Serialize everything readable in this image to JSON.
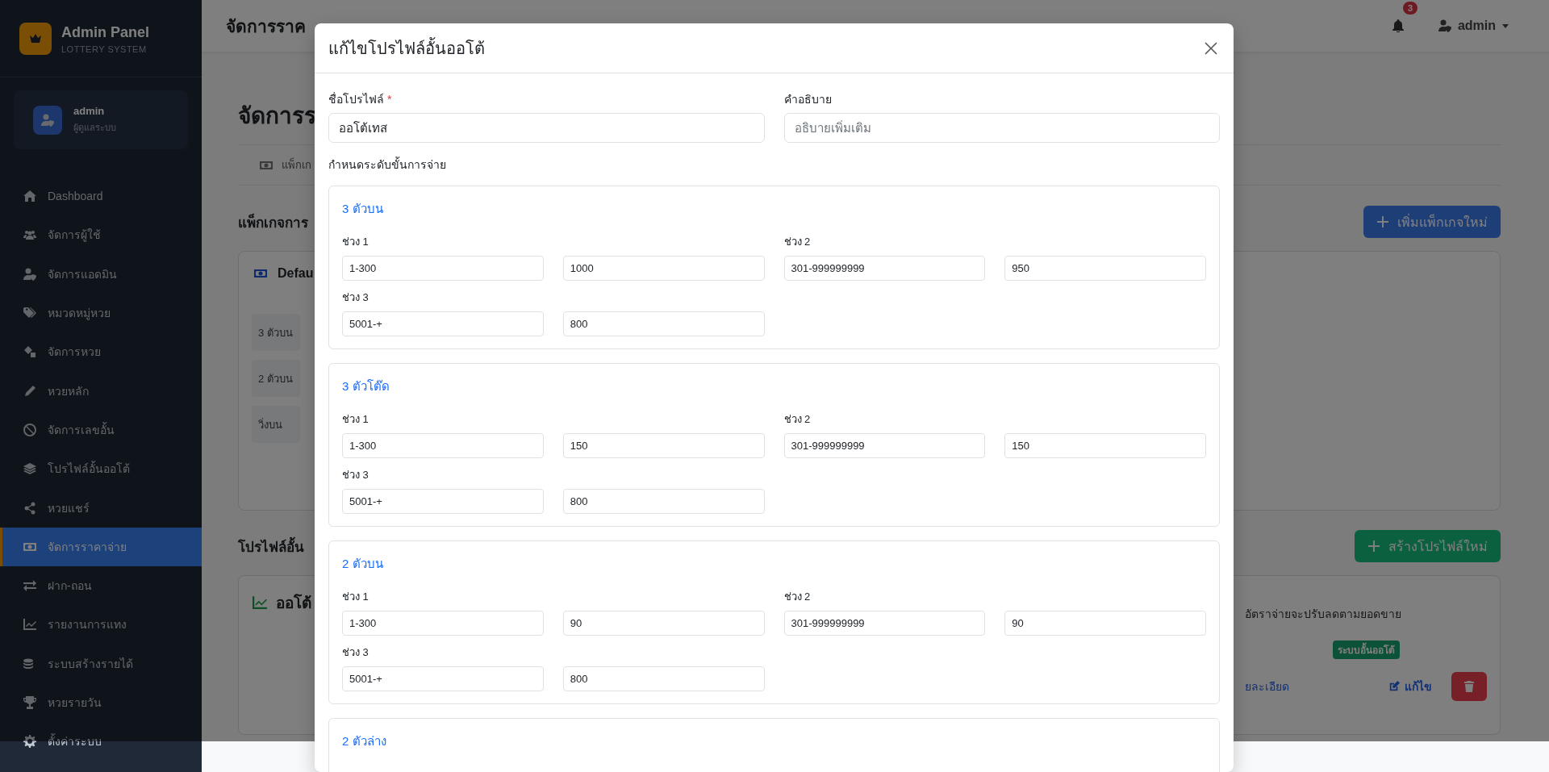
{
  "sidebar": {
    "brand_title": "Admin Panel",
    "brand_subtitle": "LOTTERY SYSTEM",
    "user": {
      "name": "admin",
      "role": "ผู้ดูแลระบบ"
    },
    "items": [
      {
        "label": "Dashboard",
        "selected": false
      },
      {
        "label": "จัดการผู้ใช้",
        "selected": false
      },
      {
        "label": "จัดการแอดมิน",
        "selected": false
      },
      {
        "label": "หมวดหมู่หวย",
        "selected": false
      },
      {
        "label": "จัดการหวย",
        "selected": false
      },
      {
        "label": "หวยหลัก",
        "selected": false
      },
      {
        "label": "จัดการเลขอั้น",
        "selected": false
      },
      {
        "label": "โปรไฟล์อั้นออโต้",
        "selected": false
      },
      {
        "label": "หวยแชร์",
        "selected": false
      },
      {
        "label": "จัดการราคาจ่าย",
        "selected": true
      },
      {
        "label": "ฝาก-ถอน",
        "selected": false
      },
      {
        "label": "รายงานการแทง",
        "selected": false
      },
      {
        "label": "ระบบสร้างรายได้",
        "selected": false
      },
      {
        "label": "หวยรายวัน",
        "selected": false
      },
      {
        "label": "ตั้งค่าระบบ",
        "selected": false
      }
    ]
  },
  "topbar": {
    "title": "จัดการราค",
    "notification_count": "3",
    "user": "admin"
  },
  "page": {
    "heading": "จัดการร",
    "tab": "แพ็กเก",
    "packages_title": "แพ็กเกจการ",
    "add_package_button": "เพิ่มแพ็กเกจใหม่",
    "package_card": {
      "title": "Defau",
      "rows": [
        "3 ตัวบน",
        "2 ตัวบน",
        "วิ่งบน"
      ]
    },
    "profiles_title": "โปรไฟล์อั้น",
    "create_profile_button": "สร้างโปรไฟล์ใหม่",
    "profile_card": {
      "title": "ออโต้",
      "description": "อัตราจ่ายจะปรับลดตามยอดขาย",
      "badge": "ระบบอั้นออโต้",
      "details_link": "ยละเอียด",
      "edit_link": "แก้ไข"
    }
  },
  "modal": {
    "title": "แก้ไขโปรไฟล์อั้นออโต้",
    "fields": [
      {
        "label": "ชื่อโปรไฟล์",
        "marker": "*",
        "value": "ออโต้เทส"
      },
      {
        "label": "คำอธิบาย",
        "placeholder": "อธิบายเพิ่มเติม"
      }
    ],
    "tiers_label": "กำหนดระดับขั้นการจ่าย",
    "groups": [
      {
        "title": "3 ตัวบน",
        "ranges": [
          {
            "label": "ช่วง 1",
            "range": "1-300",
            "rate": "1000"
          },
          {
            "label": "ช่วง 2",
            "range": "301-999999999",
            "rate": "950"
          },
          {
            "label": "ช่วง 3",
            "range": "5001-+",
            "rate": "800"
          }
        ]
      },
      {
        "title": "3 ตัวโต๊ด",
        "ranges": [
          {
            "label": "ช่วง 1",
            "range": "1-300",
            "rate": "150"
          },
          {
            "label": "ช่วง 2",
            "range": "301-999999999",
            "rate": "150"
          },
          {
            "label": "ช่วง 3",
            "range": "5001-+",
            "rate": "800"
          }
        ]
      },
      {
        "title": "2 ตัวบน",
        "ranges": [
          {
            "label": "ช่วง 1",
            "range": "1-300",
            "rate": "90"
          },
          {
            "label": "ช่วง 2",
            "range": "301-999999999",
            "rate": "90"
          },
          {
            "label": "ช่วง 3",
            "range": "5001-+",
            "rate": "800"
          }
        ]
      },
      {
        "title": "2 ตัวล่าง"
      }
    ]
  }
}
